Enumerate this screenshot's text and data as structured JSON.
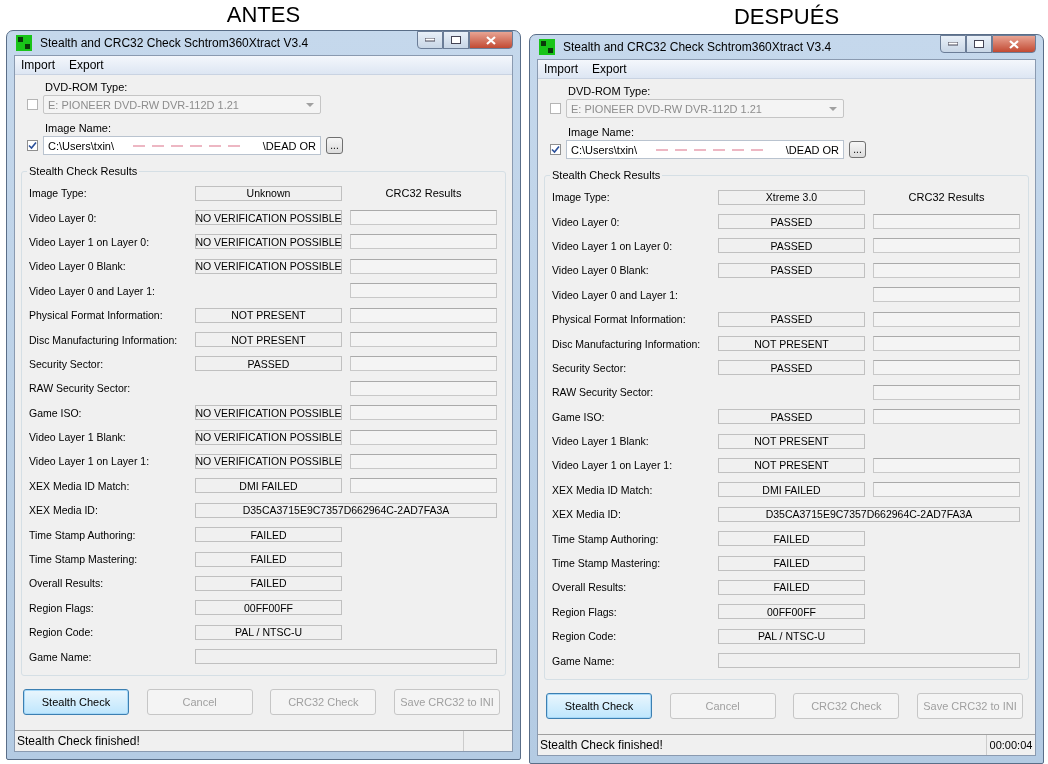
{
  "panels": [
    {
      "caption": "ANTES",
      "window": {
        "title": "Stealth and CRC32 Check Schtrom360Xtract V3.4"
      },
      "menu": [
        "Import",
        "Export"
      ],
      "dvd_rom": {
        "label": "DVD-ROM Type:",
        "checked": false,
        "disabled": true,
        "value": "E: PIONEER DVD-RW  DVR-112D 1.21"
      },
      "image_name": {
        "label": "Image Name:",
        "checked": true,
        "path_start": "C:\\Users\\txin\\",
        "path_end": "\\DEAD OR",
        "browse": "..."
      },
      "group_title": "Stealth Check Results",
      "rows": [
        {
          "kind": "header",
          "label": "Image Type:",
          "value": "Unknown",
          "crc_heading": "CRC32 Results"
        },
        {
          "kind": "pair",
          "label": "Video Layer 0:",
          "value": "NO VERIFICATION POSSIBLE"
        },
        {
          "kind": "pair",
          "label": "Video Layer 1 on Layer 0:",
          "value": "NO VERIFICATION POSSIBLE"
        },
        {
          "kind": "pair",
          "label": "Video Layer 0 Blank:",
          "value": "NO VERIFICATION POSSIBLE"
        },
        {
          "kind": "crc",
          "label": "Video Layer 0 and Layer 1:"
        },
        {
          "kind": "pair",
          "label": "Physical Format Information:",
          "value": "NOT PRESENT"
        },
        {
          "kind": "pair",
          "label": "Disc Manufacturing Information:",
          "value": "NOT PRESENT"
        },
        {
          "kind": "pair",
          "label": "Security Sector:",
          "value": "PASSED"
        },
        {
          "kind": "crc",
          "label": "RAW Security Sector:"
        },
        {
          "kind": "pair",
          "label": "Game ISO:",
          "value": "NO VERIFICATION POSSIBLE"
        },
        {
          "kind": "pair",
          "label": "Video Layer 1 Blank:",
          "value": "NO VERIFICATION POSSIBLE"
        },
        {
          "kind": "pair",
          "label": "Video Layer 1 on Layer 1:",
          "value": "NO VERIFICATION POSSIBLE"
        },
        {
          "kind": "pair",
          "label": "XEX Media ID Match:",
          "value": "DMI FAILED"
        },
        {
          "kind": "wide",
          "label": "XEX Media ID:",
          "value": "D35CA3715E9C7357D662964C-2AD7FA3A"
        },
        {
          "kind": "result",
          "label": "Time Stamp Authoring:",
          "value": "FAILED"
        },
        {
          "kind": "result",
          "label": "Time Stamp Mastering:",
          "value": "FAILED"
        },
        {
          "kind": "result",
          "label": "Overall Results:",
          "value": "FAILED"
        },
        {
          "kind": "result",
          "label": "Region Flags:",
          "value": "00FF00FF"
        },
        {
          "kind": "result",
          "label": "Region Code:",
          "value": "PAL / NTSC-U"
        },
        {
          "kind": "wide",
          "label": "Game Name:"
        }
      ],
      "buttons": [
        {
          "label": "Stealth Check",
          "disabled": false,
          "default": true
        },
        {
          "label": "Cancel",
          "disabled": true,
          "default": false
        },
        {
          "label": "CRC32 Check",
          "disabled": true,
          "default": false
        },
        {
          "label": "Save CRC32 to INI",
          "disabled": true,
          "default": false
        }
      ],
      "status_bar": {
        "message": "Stealth Check finished!"
      }
    },
    {
      "caption": "DESPUÉS",
      "window": {
        "title": "Stealth and CRC32 Check Schtrom360Xtract V3.4"
      },
      "menu": [
        "Import",
        "Export"
      ],
      "dvd_rom": {
        "label": "DVD-ROM Type:",
        "checked": false,
        "disabled": true,
        "value": "E: PIONEER DVD-RW  DVR-112D 1.21"
      },
      "image_name": {
        "label": "Image Name:",
        "checked": true,
        "path_start": "C:\\Users\\txin\\",
        "path_end": "\\DEAD OR",
        "browse": "..."
      },
      "group_title": "Stealth Check Results",
      "rows": [
        {
          "kind": "header",
          "label": "Image Type:",
          "value": "Xtreme 3.0",
          "crc_heading": "CRC32 Results"
        },
        {
          "kind": "pair",
          "label": "Video Layer 0:",
          "value": "PASSED"
        },
        {
          "kind": "pair",
          "label": "Video Layer 1 on Layer 0:",
          "value": "PASSED"
        },
        {
          "kind": "pair",
          "label": "Video Layer 0 Blank:",
          "value": "PASSED"
        },
        {
          "kind": "crc",
          "label": "Video Layer 0 and Layer 1:"
        },
        {
          "kind": "pair",
          "label": "Physical Format Information:",
          "value": "PASSED"
        },
        {
          "kind": "pair",
          "label": "Disc Manufacturing Information:",
          "value": "NOT PRESENT"
        },
        {
          "kind": "pair",
          "label": "Security Sector:",
          "value": "PASSED"
        },
        {
          "kind": "crc",
          "label": "RAW Security Sector:"
        },
        {
          "kind": "pair",
          "label": "Game ISO:",
          "value": "PASSED"
        },
        {
          "kind": "result",
          "label": "Video Layer 1 Blank:",
          "value": "NOT PRESENT"
        },
        {
          "kind": "pair",
          "label": "Video Layer 1 on Layer 1:",
          "value": "NOT PRESENT"
        },
        {
          "kind": "pair",
          "label": "XEX Media ID Match:",
          "value": "DMI FAILED"
        },
        {
          "kind": "wide",
          "label": "XEX Media ID:",
          "value": "D35CA3715E9C7357D662964C-2AD7FA3A"
        },
        {
          "kind": "result",
          "label": "Time Stamp Authoring:",
          "value": "FAILED"
        },
        {
          "kind": "result",
          "label": "Time Stamp Mastering:",
          "value": "FAILED"
        },
        {
          "kind": "result",
          "label": "Overall Results:",
          "value": "FAILED"
        },
        {
          "kind": "result",
          "label": "Region Flags:",
          "value": "00FF00FF"
        },
        {
          "kind": "result",
          "label": "Region Code:",
          "value": "PAL / NTSC-U"
        },
        {
          "kind": "wide",
          "label": "Game Name:"
        }
      ],
      "buttons": [
        {
          "label": "Stealth Check",
          "disabled": false,
          "default": true
        },
        {
          "label": "Cancel",
          "disabled": true,
          "default": false
        },
        {
          "label": "CRC32 Check",
          "disabled": true,
          "default": false
        },
        {
          "label": "Save CRC32 to INI",
          "disabled": true,
          "default": false
        }
      ],
      "status_bar": {
        "message": "Stealth Check finished!",
        "elapsed": "00:00:04"
      }
    }
  ]
}
